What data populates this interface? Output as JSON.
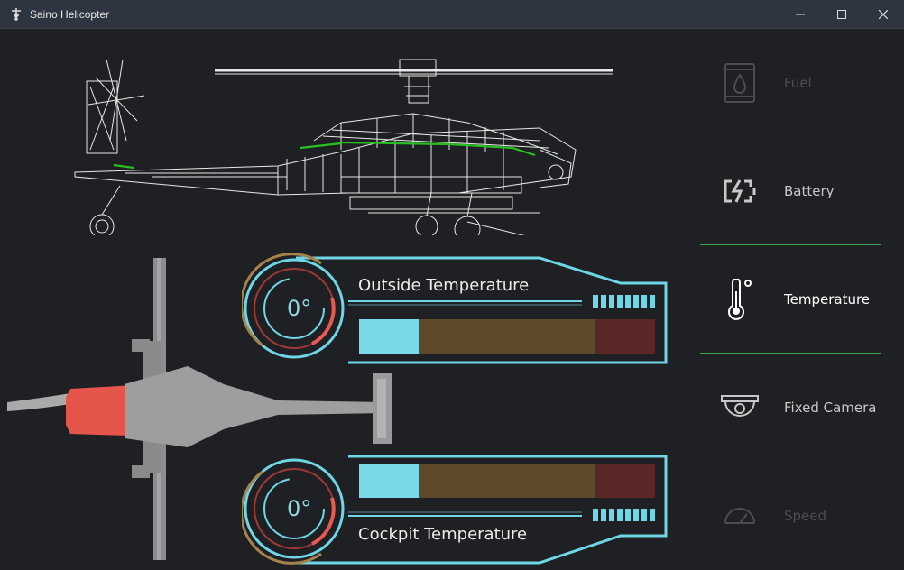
{
  "window": {
    "title": "Saino Helicopter"
  },
  "sidebar": {
    "items": [
      {
        "label": "Fuel",
        "icon": "fuel-barrel-icon"
      },
      {
        "label": "Battery",
        "icon": "battery-charge-icon"
      },
      {
        "label": "Temperature",
        "icon": "thermometer-icon"
      },
      {
        "label": "Fixed Camera",
        "icon": "dome-camera-icon"
      },
      {
        "label": "Speed",
        "icon": "speedometer-icon"
      }
    ],
    "active_index": 2
  },
  "gauges": {
    "outside": {
      "title": "Outside Temperature",
      "value": "0°",
      "segments": [
        0.2,
        0.6,
        0.2
      ]
    },
    "cockpit": {
      "title": "Cockpit Temperature",
      "value": "0°",
      "segments": [
        0.2,
        0.6,
        0.2
      ]
    }
  },
  "colors": {
    "accent_cyan": "#6fd6e8",
    "divider_green": "#3fa34d",
    "gauge_red": "#c8423a",
    "gauge_gold": "#a5824a",
    "heat_red": "#e65a52"
  }
}
